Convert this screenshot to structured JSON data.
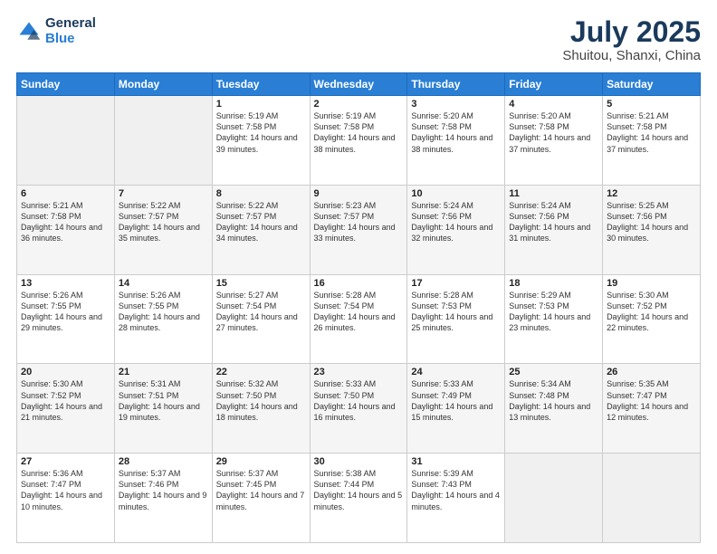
{
  "header": {
    "logo_general": "General",
    "logo_blue": "Blue",
    "month_year": "July 2025",
    "location": "Shuitou, Shanxi, China"
  },
  "days_of_week": [
    "Sunday",
    "Monday",
    "Tuesday",
    "Wednesday",
    "Thursday",
    "Friday",
    "Saturday"
  ],
  "weeks": [
    [
      {
        "day": "",
        "sunrise": "",
        "sunset": "",
        "daylight": "",
        "empty": true
      },
      {
        "day": "",
        "sunrise": "",
        "sunset": "",
        "daylight": "",
        "empty": true
      },
      {
        "day": "1",
        "sunrise": "Sunrise: 5:19 AM",
        "sunset": "Sunset: 7:58 PM",
        "daylight": "Daylight: 14 hours and 39 minutes."
      },
      {
        "day": "2",
        "sunrise": "Sunrise: 5:19 AM",
        "sunset": "Sunset: 7:58 PM",
        "daylight": "Daylight: 14 hours and 38 minutes."
      },
      {
        "day": "3",
        "sunrise": "Sunrise: 5:20 AM",
        "sunset": "Sunset: 7:58 PM",
        "daylight": "Daylight: 14 hours and 38 minutes."
      },
      {
        "day": "4",
        "sunrise": "Sunrise: 5:20 AM",
        "sunset": "Sunset: 7:58 PM",
        "daylight": "Daylight: 14 hours and 37 minutes."
      },
      {
        "day": "5",
        "sunrise": "Sunrise: 5:21 AM",
        "sunset": "Sunset: 7:58 PM",
        "daylight": "Daylight: 14 hours and 37 minutes."
      }
    ],
    [
      {
        "day": "6",
        "sunrise": "Sunrise: 5:21 AM",
        "sunset": "Sunset: 7:58 PM",
        "daylight": "Daylight: 14 hours and 36 minutes."
      },
      {
        "day": "7",
        "sunrise": "Sunrise: 5:22 AM",
        "sunset": "Sunset: 7:57 PM",
        "daylight": "Daylight: 14 hours and 35 minutes."
      },
      {
        "day": "8",
        "sunrise": "Sunrise: 5:22 AM",
        "sunset": "Sunset: 7:57 PM",
        "daylight": "Daylight: 14 hours and 34 minutes."
      },
      {
        "day": "9",
        "sunrise": "Sunrise: 5:23 AM",
        "sunset": "Sunset: 7:57 PM",
        "daylight": "Daylight: 14 hours and 33 minutes."
      },
      {
        "day": "10",
        "sunrise": "Sunrise: 5:24 AM",
        "sunset": "Sunset: 7:56 PM",
        "daylight": "Daylight: 14 hours and 32 minutes."
      },
      {
        "day": "11",
        "sunrise": "Sunrise: 5:24 AM",
        "sunset": "Sunset: 7:56 PM",
        "daylight": "Daylight: 14 hours and 31 minutes."
      },
      {
        "day": "12",
        "sunrise": "Sunrise: 5:25 AM",
        "sunset": "Sunset: 7:56 PM",
        "daylight": "Daylight: 14 hours and 30 minutes."
      }
    ],
    [
      {
        "day": "13",
        "sunrise": "Sunrise: 5:26 AM",
        "sunset": "Sunset: 7:55 PM",
        "daylight": "Daylight: 14 hours and 29 minutes."
      },
      {
        "day": "14",
        "sunrise": "Sunrise: 5:26 AM",
        "sunset": "Sunset: 7:55 PM",
        "daylight": "Daylight: 14 hours and 28 minutes."
      },
      {
        "day": "15",
        "sunrise": "Sunrise: 5:27 AM",
        "sunset": "Sunset: 7:54 PM",
        "daylight": "Daylight: 14 hours and 27 minutes."
      },
      {
        "day": "16",
        "sunrise": "Sunrise: 5:28 AM",
        "sunset": "Sunset: 7:54 PM",
        "daylight": "Daylight: 14 hours and 26 minutes."
      },
      {
        "day": "17",
        "sunrise": "Sunrise: 5:28 AM",
        "sunset": "Sunset: 7:53 PM",
        "daylight": "Daylight: 14 hours and 25 minutes."
      },
      {
        "day": "18",
        "sunrise": "Sunrise: 5:29 AM",
        "sunset": "Sunset: 7:53 PM",
        "daylight": "Daylight: 14 hours and 23 minutes."
      },
      {
        "day": "19",
        "sunrise": "Sunrise: 5:30 AM",
        "sunset": "Sunset: 7:52 PM",
        "daylight": "Daylight: 14 hours and 22 minutes."
      }
    ],
    [
      {
        "day": "20",
        "sunrise": "Sunrise: 5:30 AM",
        "sunset": "Sunset: 7:52 PM",
        "daylight": "Daylight: 14 hours and 21 minutes."
      },
      {
        "day": "21",
        "sunrise": "Sunrise: 5:31 AM",
        "sunset": "Sunset: 7:51 PM",
        "daylight": "Daylight: 14 hours and 19 minutes."
      },
      {
        "day": "22",
        "sunrise": "Sunrise: 5:32 AM",
        "sunset": "Sunset: 7:50 PM",
        "daylight": "Daylight: 14 hours and 18 minutes."
      },
      {
        "day": "23",
        "sunrise": "Sunrise: 5:33 AM",
        "sunset": "Sunset: 7:50 PM",
        "daylight": "Daylight: 14 hours and 16 minutes."
      },
      {
        "day": "24",
        "sunrise": "Sunrise: 5:33 AM",
        "sunset": "Sunset: 7:49 PM",
        "daylight": "Daylight: 14 hours and 15 minutes."
      },
      {
        "day": "25",
        "sunrise": "Sunrise: 5:34 AM",
        "sunset": "Sunset: 7:48 PM",
        "daylight": "Daylight: 14 hours and 13 minutes."
      },
      {
        "day": "26",
        "sunrise": "Sunrise: 5:35 AM",
        "sunset": "Sunset: 7:47 PM",
        "daylight": "Daylight: 14 hours and 12 minutes."
      }
    ],
    [
      {
        "day": "27",
        "sunrise": "Sunrise: 5:36 AM",
        "sunset": "Sunset: 7:47 PM",
        "daylight": "Daylight: 14 hours and 10 minutes."
      },
      {
        "day": "28",
        "sunrise": "Sunrise: 5:37 AM",
        "sunset": "Sunset: 7:46 PM",
        "daylight": "Daylight: 14 hours and 9 minutes."
      },
      {
        "day": "29",
        "sunrise": "Sunrise: 5:37 AM",
        "sunset": "Sunset: 7:45 PM",
        "daylight": "Daylight: 14 hours and 7 minutes."
      },
      {
        "day": "30",
        "sunrise": "Sunrise: 5:38 AM",
        "sunset": "Sunset: 7:44 PM",
        "daylight": "Daylight: 14 hours and 5 minutes."
      },
      {
        "day": "31",
        "sunrise": "Sunrise: 5:39 AM",
        "sunset": "Sunset: 7:43 PM",
        "daylight": "Daylight: 14 hours and 4 minutes."
      },
      {
        "day": "",
        "sunrise": "",
        "sunset": "",
        "daylight": "",
        "empty": true
      },
      {
        "day": "",
        "sunrise": "",
        "sunset": "",
        "daylight": "",
        "empty": true
      }
    ]
  ]
}
